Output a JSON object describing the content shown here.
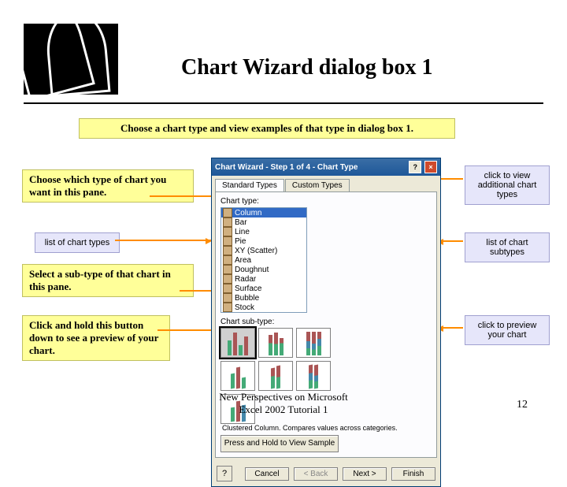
{
  "slide": {
    "title": "Chart Wizard dialog box 1",
    "intro": "Choose a chart type and view examples of that type in dialog box 1.",
    "note_choose_type": "Choose which type of chart you want in this pane.",
    "note_select_sub": "Select a sub-type of that chart in this pane.",
    "note_preview": "Click and hold this button down to see a preview of your chart.",
    "footer_line1": "New Perspectives on Microsoft",
    "footer_line2": "Excel 2002 Tutorial 1",
    "page": "12"
  },
  "balloon": {
    "list_types": "list of chart types",
    "list_subtypes": "list of chart subtypes",
    "custom_types": "click to view additional chart types",
    "preview": "click to preview your chart"
  },
  "dialog": {
    "title": "Chart Wizard - Step 1 of 4 - Chart Type",
    "tab_std": "Standard Types",
    "tab_custom": "Custom Types",
    "label_type": "Chart type:",
    "label_subtype": "Chart sub-type:",
    "types": [
      "Column",
      "Bar",
      "Line",
      "Pie",
      "XY (Scatter)",
      "Area",
      "Doughnut",
      "Radar",
      "Surface",
      "Bubble",
      "Stock"
    ],
    "desc": "Clustered Column. Compares values across categories.",
    "sample_btn": "Press and Hold to View Sample",
    "btn_cancel": "Cancel",
    "btn_back": "< Back",
    "btn_next": "Next >",
    "btn_finish": "Finish"
  }
}
